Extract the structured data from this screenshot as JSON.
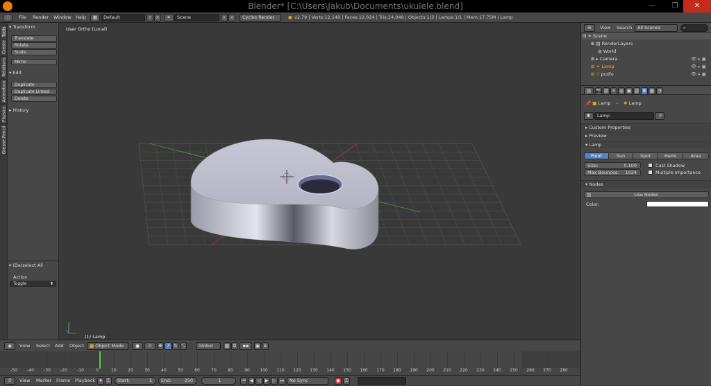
{
  "titlebar": {
    "title": "Blender* [C:\\Users\\Jakub\\Documents\\ukulele.blend]",
    "min": "—",
    "max": "❐",
    "close": "✕"
  },
  "info": {
    "menus": [
      "File",
      "Render",
      "Window",
      "Help"
    ],
    "layout": "Default",
    "scene": "Scene",
    "engine": "Cycles Render",
    "stats": "v2.79 | Verts:12,149 | Faces:12,024 | Tris:24,048 | Objects:1/3 | Lamps:1/1 | Mem:17.75M | Lamp"
  },
  "tabs": [
    "Tools",
    "Create",
    "Relations",
    "Animation",
    "Physics",
    "Grease Pencil"
  ],
  "toolshelf": {
    "transform_header": "Transform",
    "transform": [
      "Translate",
      "Rotate",
      "Scale"
    ],
    "mirror": "Mirror",
    "edit_header": "Edit",
    "edit": [
      "Duplicate",
      "Duplicate Linked",
      "Delete"
    ],
    "history_header": "History",
    "op_header": "(De)select All",
    "action_label": "Action",
    "action_value": "Toggle"
  },
  "viewport": {
    "label": "User Ortho (Local)",
    "object": "(1) Lamp"
  },
  "vp_header": {
    "menus": [
      "View",
      "Select",
      "Add",
      "Object"
    ],
    "mode": "Object Mode",
    "orientation": "Global"
  },
  "timeline": {
    "ticks": [
      "-50",
      "-40",
      "-30",
      "-20",
      "-10",
      "0",
      "10",
      "20",
      "30",
      "40",
      "50",
      "60",
      "70",
      "80",
      "90",
      "100",
      "110",
      "120",
      "130",
      "140",
      "150",
      "160",
      "170",
      "180",
      "190",
      "200",
      "210",
      "220",
      "230",
      "240",
      "250",
      "260",
      "270",
      "280"
    ]
  },
  "tl_bar": {
    "menus": [
      "View",
      "Marker",
      "Frame",
      "Playback"
    ],
    "start": "Start:",
    "start_val": "1",
    "end": "End:",
    "end_val": "250",
    "current": "1",
    "sync": "No Sync"
  },
  "outliner": {
    "menus": [
      "View",
      "Search"
    ],
    "filter": "All Scenes",
    "items": [
      "Scene",
      "RenderLayers",
      "World",
      "Camera",
      "Lamp",
      "pudlo"
    ]
  },
  "props": {
    "breadcrumb": [
      "Lamp",
      "Lamp"
    ],
    "datablock": "Lamp",
    "fake": "F",
    "panels": {
      "custom": "Custom Properties",
      "preview": "Preview",
      "lamp": "Lamp",
      "nodes": "Nodes"
    },
    "types": [
      "Point",
      "Sun",
      "Spot",
      "Hemi",
      "Area"
    ],
    "size_label": "Size:",
    "size_val": "0.100",
    "bounces_label": "Max Bounces:",
    "bounces_val": "1024",
    "cast_shadow": "Cast Shadow",
    "mis": "Multiple Importance",
    "use_nodes": "Use Nodes",
    "color_label": "Color:"
  },
  "colors": {
    "accent": "#5680c2",
    "selected": "#e87d0d",
    "mesh": "#b8b8c8"
  }
}
